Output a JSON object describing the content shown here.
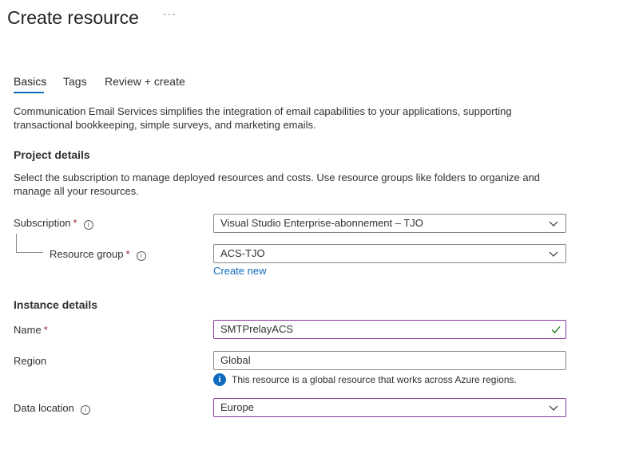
{
  "header": {
    "title": "Create resource",
    "more_label": "···"
  },
  "tabs": [
    {
      "label": "Basics",
      "active": true
    },
    {
      "label": "Tags",
      "active": false
    },
    {
      "label": "Review + create",
      "active": false
    }
  ],
  "description": "Communication Email Services simplifies the integration of email capabilities to your applications, supporting transactional bookkeeping, simple surveys, and marketing emails.",
  "project_details": {
    "title": "Project details",
    "description": "Select the subscription to manage deployed resources and costs. Use resource groups like folders to organize and manage all your resources.",
    "subscription": {
      "label": "Subscription",
      "required": "*",
      "value": "Visual Studio Enterprise-abonnement – TJO"
    },
    "resource_group": {
      "label": "Resource group",
      "required": "*",
      "value": "ACS-TJO",
      "create_new": "Create new"
    }
  },
  "instance_details": {
    "title": "Instance details",
    "name": {
      "label": "Name",
      "required": "*",
      "value": "SMTPrelayACS"
    },
    "region": {
      "label": "Region",
      "value": "Global",
      "info": "This resource is a global resource that works across Azure regions."
    },
    "data_location": {
      "label": "Data location",
      "value": "Europe"
    }
  },
  "icons": {
    "info": "info-icon",
    "chevron": "chevron-down-icon",
    "check": "checkmark-icon"
  },
  "colors": {
    "accent": "#0f6cbd",
    "required": "#a4262c",
    "valid": "#107c10",
    "focus_border": "#8a3ca0"
  }
}
